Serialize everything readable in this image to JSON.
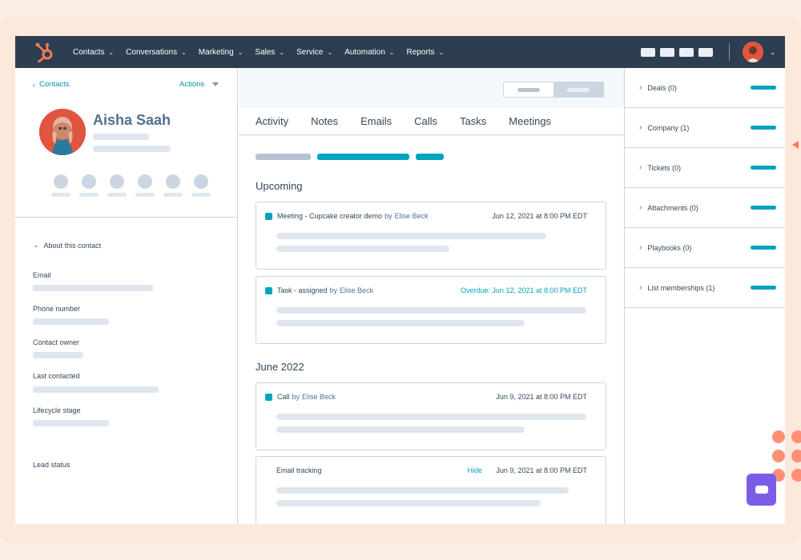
{
  "topnav": {
    "items": [
      {
        "label": "Contacts"
      },
      {
        "label": "Conversations"
      },
      {
        "label": "Marketing"
      },
      {
        "label": "Sales"
      },
      {
        "label": "Service"
      },
      {
        "label": "Automation"
      },
      {
        "label": "Reports"
      }
    ],
    "logo_icon": "hubspot-sprocket-icon",
    "brand_color": "#ff7a59",
    "nav_bg": "#2d3e50"
  },
  "left": {
    "back_label": "Contacts",
    "actions_label": "Actions",
    "contact_name": "Aisha Saah",
    "about_label": "About this contact",
    "properties": [
      {
        "label": "Email"
      },
      {
        "label": "Phone number"
      },
      {
        "label": "Contact owner"
      },
      {
        "label": "Last contacted"
      },
      {
        "label": "Lifecycle stage"
      },
      {
        "label": "Lead status"
      }
    ]
  },
  "middle": {
    "tabs": [
      {
        "label": "Activity"
      },
      {
        "label": "Notes"
      },
      {
        "label": "Emails"
      },
      {
        "label": "Calls"
      },
      {
        "label": "Tasks"
      },
      {
        "label": "Meetings"
      }
    ],
    "sections": {
      "upcoming": "Upcoming",
      "june": "June 2022"
    },
    "cards": [
      {
        "title": "Meeting - Cupcake creator demo",
        "by": "by",
        "who": "Elise Beck",
        "date": "Jun 12, 2021 at 8:00 PM EDT"
      },
      {
        "title": "Task - assigned",
        "by": "by",
        "who": "Elise Beck",
        "date": "Overdue: Jun 12, 2021 at 8:00 PM EDT"
      },
      {
        "title": "Call",
        "by": "by",
        "who": "Elise Beck",
        "date": "Jun 9, 2021 at 8:00 PM EDT"
      },
      {
        "title": "Email tracking",
        "hide": "Hide",
        "date": "Jun 9, 2021 at 8:00 PM EDT"
      }
    ],
    "accent_color": "#00a4bd"
  },
  "right": {
    "items": [
      {
        "label": "Deals (0)"
      },
      {
        "label": "Company (1)"
      },
      {
        "label": "Tickets (0)"
      },
      {
        "label": "Attachments (0)"
      },
      {
        "label": "Playbooks (0)"
      },
      {
        "label": "List memberships (1)"
      }
    ]
  }
}
